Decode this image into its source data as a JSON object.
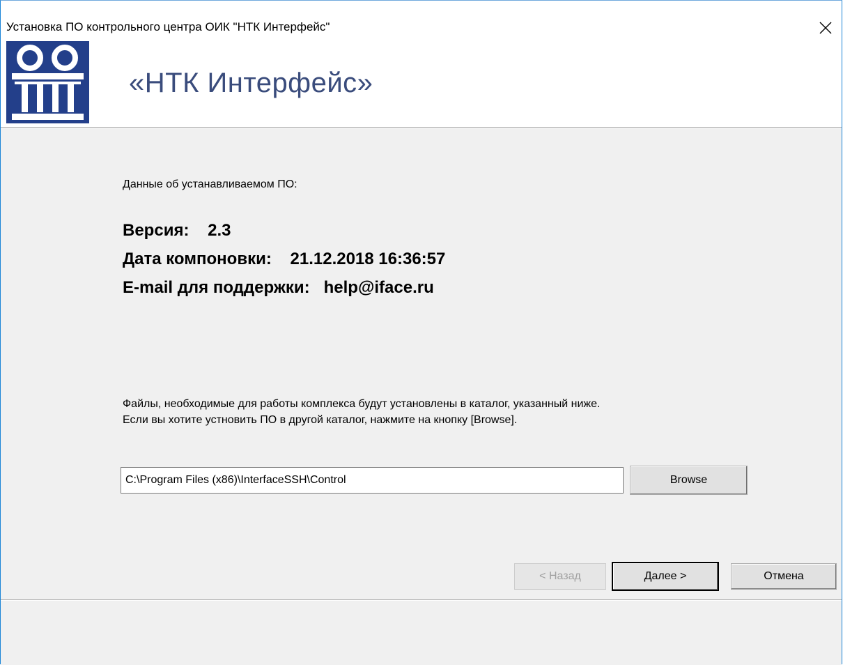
{
  "window": {
    "title": "Установка ПО контрольного центра ОИК \"НТК Интерфейс\"",
    "close_icon": "close-icon"
  },
  "header": {
    "brand": "«НТК Интерфейс»",
    "logo_icon": "ntk-logo-icon",
    "logo_color": "#233f8a",
    "brand_color": "#3a4c7c"
  },
  "info": {
    "label": "Данные об устанавливаемом ПО:",
    "version_line": "Версия:    2.3",
    "build_line": "Дата компоновки:    21.12.2018 16:36:57",
    "email_line": "E-mail для поддержки:   help@iface.ru"
  },
  "description": {
    "text": "Файлы, необходимые для работы комплекса будут установлены в каталог, указанный ниже. Если вы хотите устновить ПО в другой каталог, нажмите на кнопку [Browse]."
  },
  "path": {
    "value": "C:\\Program Files (x86)\\InterfaceSSH\\Control",
    "browse_label": "Browse"
  },
  "footer": {
    "back_label": "< Назад",
    "next_label": "Далее >",
    "cancel_label": "Отмена"
  }
}
